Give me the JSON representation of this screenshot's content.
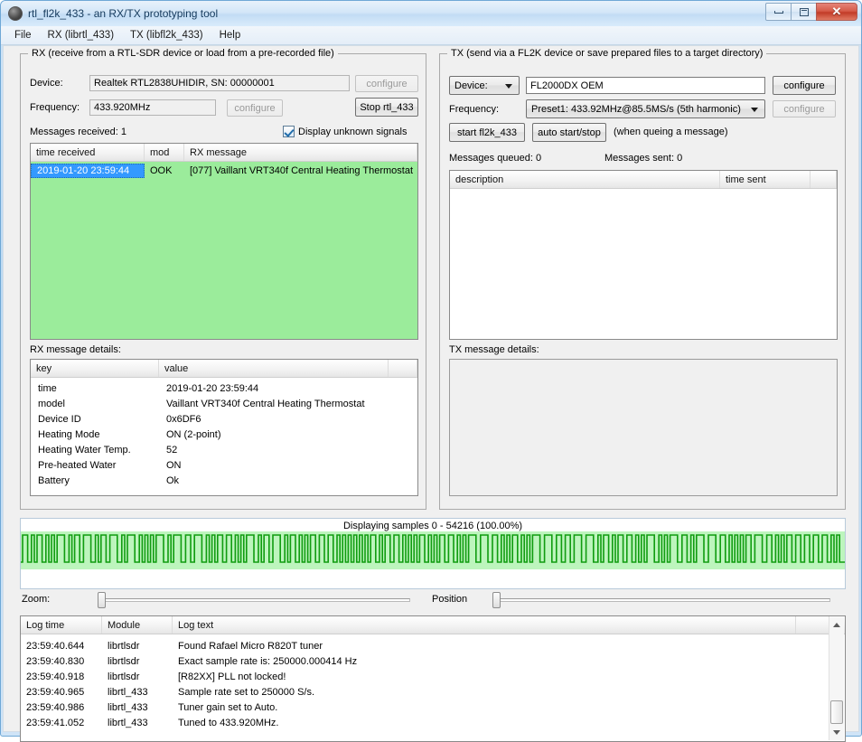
{
  "window": {
    "title": "rtl_fl2k_433 - an RX/TX prototyping tool",
    "icon": "app-circle-icon",
    "buttons": {
      "minimize": "minimize-icon",
      "maximize": "maximize-icon",
      "close": "✕"
    }
  },
  "menu": {
    "items": [
      "File",
      "RX (librtl_433)",
      "TX (libfl2k_433)",
      "Help"
    ]
  },
  "rx": {
    "group_title": "RX (receive from a RTL-SDR device or load from a pre-recorded file)",
    "device_label": "Device:",
    "device_value": "Realtek RTL2838UHIDIR, SN: 00000001",
    "device_configure": "configure",
    "frequency_label": "Frequency:",
    "frequency_value": "433.920MHz",
    "frequency_configure": "configure",
    "stop_button": "Stop rtl_433",
    "messages_received": "Messages received: 1",
    "display_unknown_label": "Display unknown signals",
    "display_unknown_checked": true,
    "list": {
      "columns": [
        "time received",
        "mod",
        "RX message"
      ],
      "rows": [
        {
          "time": "2019-01-20 23:59:44",
          "mod": "OOK",
          "message": "[077] Vaillant VRT340f Central Heating Thermostat",
          "selected": true
        }
      ]
    },
    "details_label": "RX message details:",
    "details": {
      "columns": [
        "key",
        "value"
      ],
      "rows": [
        {
          "key": "time",
          "value": "2019-01-20 23:59:44"
        },
        {
          "key": "model",
          "value": "Vaillant VRT340f Central Heating Thermostat"
        },
        {
          "key": "Device ID",
          "value": "0x6DF6"
        },
        {
          "key": "Heating Mode",
          "value": "ON (2-point)"
        },
        {
          "key": "Heating Water Temp.",
          "value": "52"
        },
        {
          "key": "Pre-heated Water",
          "value": "ON"
        },
        {
          "key": "Battery",
          "value": "Ok"
        }
      ]
    }
  },
  "tx": {
    "group_title": "TX (send via a FL2K device or save prepared files to a target directory)",
    "device_button": "Device:",
    "device_value": "FL2000DX OEM",
    "device_configure": "configure",
    "frequency_label": "Frequency:",
    "frequency_value": "Preset1: 433.92MHz@85.5MS/s (5th harmonic)",
    "frequency_configure": "configure",
    "start_button": "start fl2k_433",
    "auto_button": "auto start/stop",
    "auto_note": "(when queing a message)",
    "messages_queued": "Messages queued: 0",
    "messages_sent": "Messages sent: 0",
    "queue": {
      "columns": [
        "description",
        "time sent"
      ],
      "rows": []
    },
    "details_label": "TX message details:"
  },
  "waveform": {
    "caption": "Displaying samples 0 - 54216 (100.00%)",
    "background": "#bdf5bd",
    "stroke": "#109c10",
    "zoom_label": "Zoom:",
    "position_label": "Position"
  },
  "log": {
    "columns": [
      "Log time",
      "Module",
      "Log text"
    ],
    "rows": [
      {
        "time": "23:59:40.644",
        "module": "librtlsdr",
        "text": "Found Rafael Micro R820T tuner"
      },
      {
        "time": "23:59:40.830",
        "module": "librtlsdr",
        "text": "Exact sample rate is: 250000.000414 Hz"
      },
      {
        "time": "23:59:40.918",
        "module": "librtlsdr",
        "text": "[R82XX] PLL not locked!"
      },
      {
        "time": "23:59:40.965",
        "module": "librtl_433",
        "text": "Sample rate set to 250000 S/s."
      },
      {
        "time": "23:59:40.986",
        "module": "librtl_433",
        "text": "Tuner gain set to Auto."
      },
      {
        "time": "23:59:41.052",
        "module": "librtl_433",
        "text": "Tuned to 433.920MHz."
      }
    ],
    "scroll_up_icon": "scroll-up-icon",
    "scroll_down_icon": "scroll-down-icon"
  },
  "colors": {
    "accent": "#3399ff",
    "list_background": "#9bec9b",
    "wave_stroke": "#109c10",
    "wave_fill": "#bdf5bd"
  }
}
